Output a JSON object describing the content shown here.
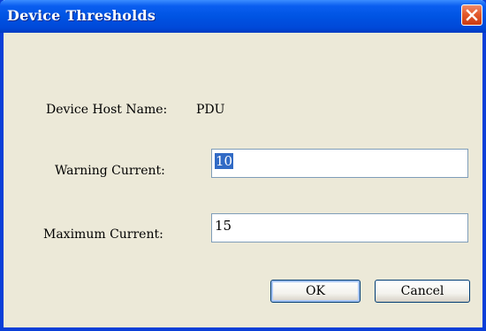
{
  "window": {
    "title": "Device Thresholds",
    "close_icon": "close-icon",
    "titlebar_color": "#0054e3",
    "close_color": "#e35a2c"
  },
  "form": {
    "host_label": "Device Host Name:",
    "host_value": "PDU",
    "warning_label": "Warning Current:",
    "warning_value": "10",
    "maximum_label": "Maximum Current:",
    "maximum_value": "15"
  },
  "buttons": {
    "ok_label": "OK",
    "cancel_label": "Cancel"
  }
}
